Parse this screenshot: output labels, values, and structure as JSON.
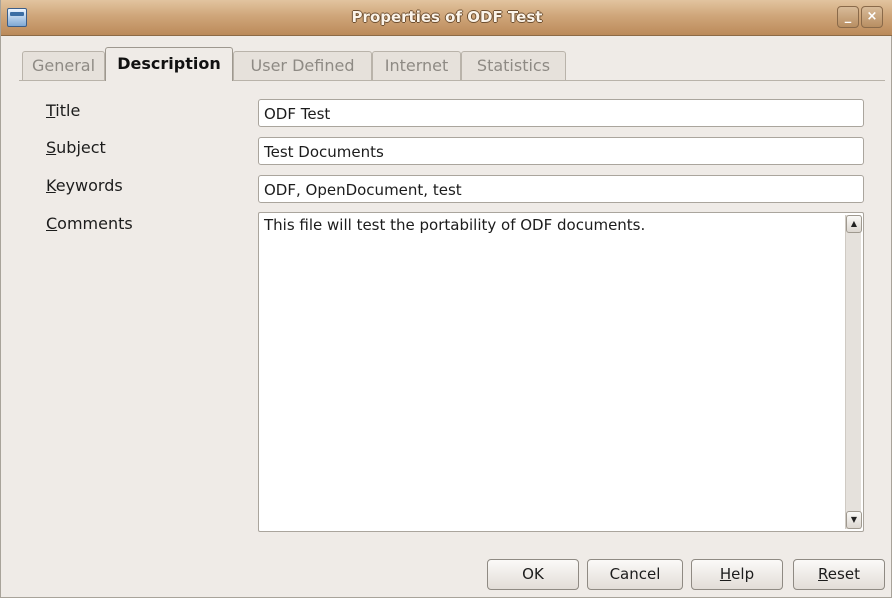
{
  "window": {
    "title": "Properties of ODF Test",
    "minimize_glyph": "_",
    "close_glyph": "×"
  },
  "tabs": [
    {
      "label": "General",
      "active": false
    },
    {
      "label": "Description",
      "active": true
    },
    {
      "label": "User Defined",
      "active": false
    },
    {
      "label": "Internet",
      "active": false
    },
    {
      "label": "Statistics",
      "active": false
    }
  ],
  "fields": {
    "title": {
      "mnemonic": "T",
      "label_rest": "itle",
      "value": "ODF Test"
    },
    "subject": {
      "mnemonic": "S",
      "label_rest": "ubject",
      "value": "Test Documents"
    },
    "keywords": {
      "mnemonic": "K",
      "label_rest": "eywords",
      "value": "ODF, OpenDocument, test"
    },
    "comments": {
      "mnemonic": "C",
      "label_rest": "omments",
      "value": "This file will test the portability of ODF documents."
    }
  },
  "scroll": {
    "up_glyph": "▲",
    "down_glyph": "▼"
  },
  "buttons": {
    "ok": {
      "label": "OK"
    },
    "cancel": {
      "label": "Cancel"
    },
    "help": {
      "mnemonic": "H",
      "rest": "elp"
    },
    "reset": {
      "mnemonic": "R",
      "rest": "eset"
    }
  }
}
